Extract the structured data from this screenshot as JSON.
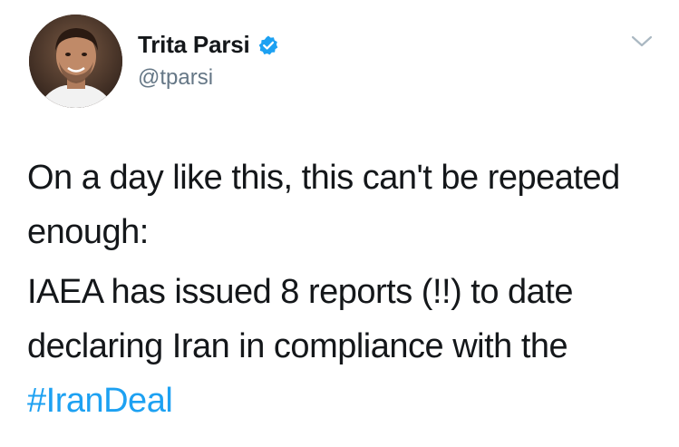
{
  "author": {
    "display_name": "Trita Parsi",
    "handle": "@tparsi",
    "verified": true
  },
  "tweet": {
    "paragraph_1": "On a day like this, this can't be repeated enough:",
    "paragraph_2_text": "IAEA has issued 8 reports (!!) to date declaring Iran in compliance with the",
    "hashtag": "#IranDeal"
  },
  "icons": {
    "verified": "verified-badge-icon",
    "menu": "chevron-down-icon"
  },
  "colors": {
    "link": "#1da1f2",
    "text": "#14171a",
    "secondary_text": "#657786",
    "verified": "#1da1f2"
  }
}
